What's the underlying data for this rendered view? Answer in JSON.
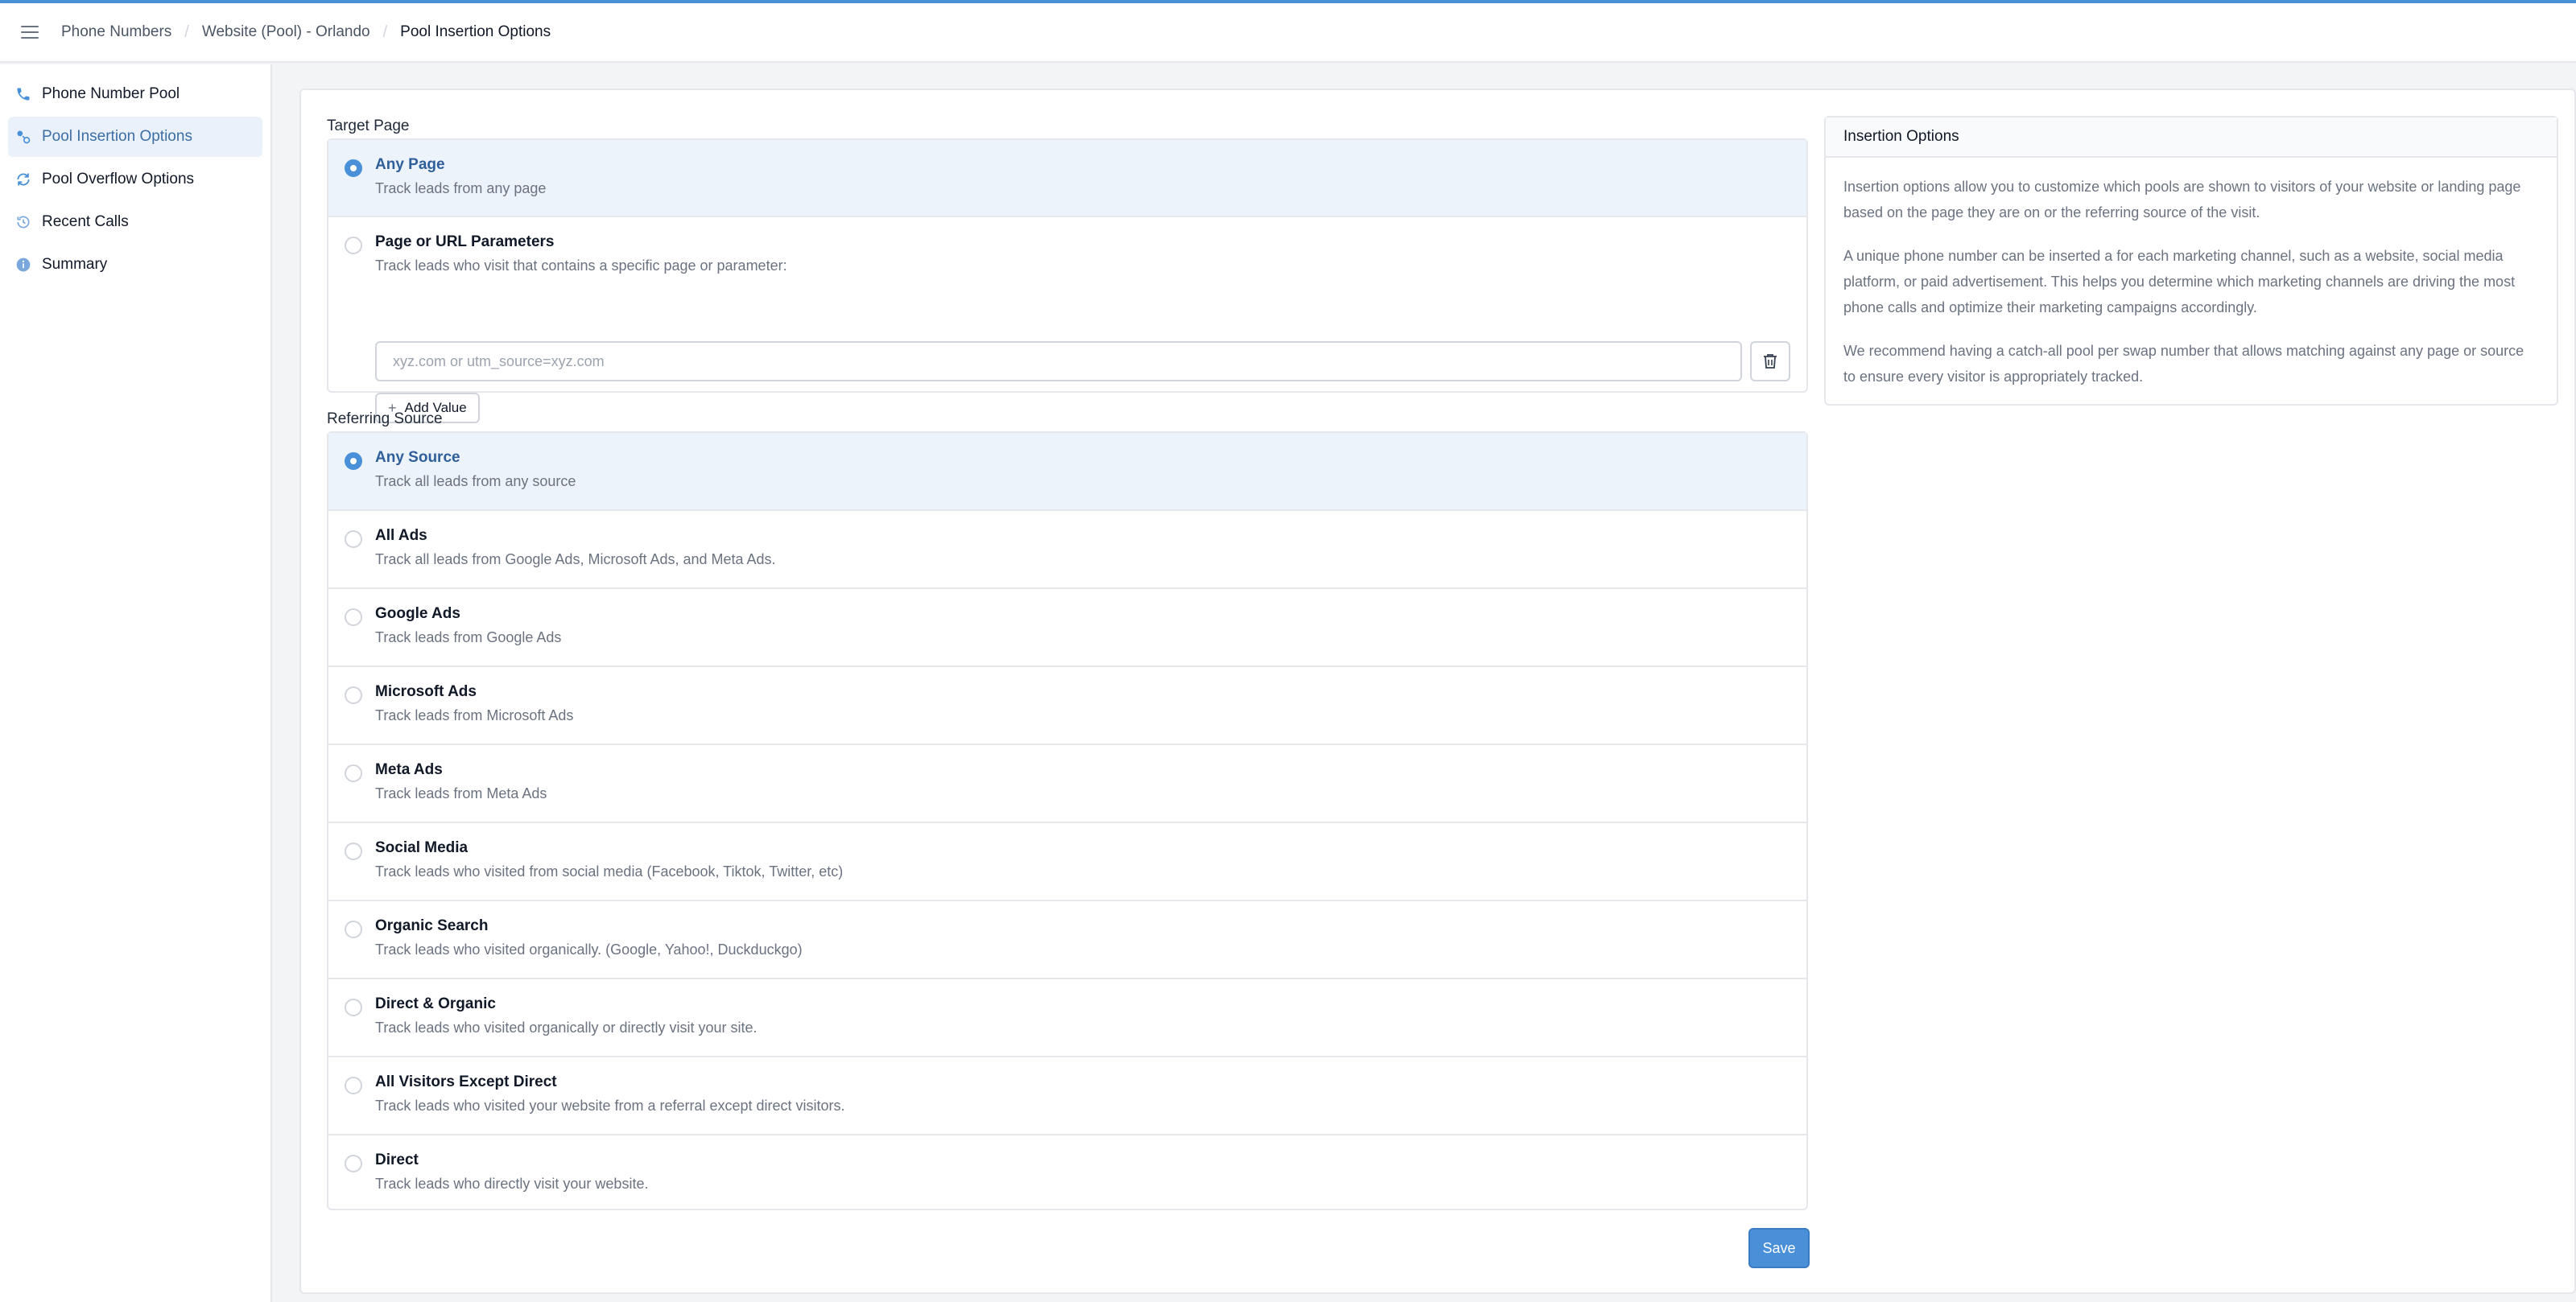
{
  "breadcrumbs": [
    "Phone Numbers",
    "Website (Pool) - Orlando",
    "Pool Insertion Options"
  ],
  "sidebar": {
    "items": [
      {
        "label": "Phone Number Pool",
        "icon": "phone-icon"
      },
      {
        "label": "Pool Insertion Options",
        "icon": "insertion-icon",
        "active": true
      },
      {
        "label": "Pool Overflow Options",
        "icon": "refresh-icon"
      },
      {
        "label": "Recent Calls",
        "icon": "history-icon"
      },
      {
        "label": "Summary",
        "icon": "info-icon"
      }
    ]
  },
  "target_page": {
    "label": "Target Page",
    "options": [
      {
        "title": "Any Page",
        "desc": "Track leads from any page",
        "selected": true
      },
      {
        "title": "Page or URL Parameters",
        "desc": "Track leads who visit that contains a specific page or parameter:",
        "selected": false
      }
    ],
    "url_input": {
      "value": "",
      "placeholder": "xyz.com or utm_source=xyz.com"
    },
    "add_value_label": "Add Value"
  },
  "referring_source": {
    "label": "Referring Source",
    "options": [
      {
        "title": "Any Source",
        "desc": "Track all leads from any source",
        "selected": true
      },
      {
        "title": "All Ads",
        "desc": "Track all leads from Google Ads, Microsoft Ads, and Meta Ads.",
        "selected": false
      },
      {
        "title": "Google Ads",
        "desc": "Track leads from Google Ads",
        "selected": false
      },
      {
        "title": "Microsoft Ads",
        "desc": "Track leads from Microsoft Ads",
        "selected": false
      },
      {
        "title": "Meta Ads",
        "desc": "Track leads from Meta Ads",
        "selected": false
      },
      {
        "title": "Social Media",
        "desc": "Track leads who visited from social media (Facebook, Tiktok, Twitter, etc)",
        "selected": false
      },
      {
        "title": "Organic Search",
        "desc": "Track leads who visited organically. (Google, Yahoo!, Duckduckgo)",
        "selected": false
      },
      {
        "title": "Direct & Organic",
        "desc": "Track leads who visited organically or directly visit your site.",
        "selected": false
      },
      {
        "title": "All Visitors Except Direct",
        "desc": "Track leads who visited your website from a referral except direct visitors.",
        "selected": false
      },
      {
        "title": "Direct",
        "desc": "Track leads who directly visit your website.",
        "selected": false
      }
    ]
  },
  "save_label": "Save",
  "info": {
    "title": "Insertion Options",
    "paragraphs": [
      "Insertion options allow you to customize which pools are shown to visitors of your website or landing page based on the page they are on or the referring source of the visit.",
      "A unique phone number can be inserted a for each marketing channel, such as a website, social media platform, or paid advertisement. This helps you determine which marketing channels are driving the most phone calls and optimize their marketing campaigns accordingly.",
      "We recommend having a catch-all pool per swap number that allows matching against any page or source to ensure every visitor is appropriately tracked."
    ]
  },
  "colors": {
    "accent": "#4a90d9",
    "selected_bg": "#edf3fb",
    "sidebar_active_bg": "#eaf1fb"
  }
}
